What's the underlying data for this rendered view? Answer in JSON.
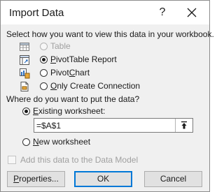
{
  "window": {
    "title": "Import Data",
    "help_glyph": "?",
    "close_icon": "close-icon"
  },
  "view_section": {
    "heading": "Select how you want to view this data in your workbook.",
    "options": [
      {
        "label": "Table",
        "selected": false,
        "enabled": false,
        "icon": "table-icon"
      },
      {
        "label": "PivotTable Report",
        "selected": true,
        "enabled": true,
        "icon": "pivottable-icon"
      },
      {
        "label": "PivotChart",
        "selected": false,
        "enabled": true,
        "icon": "pivotchart-icon"
      },
      {
        "label": "Only Create Connection",
        "selected": false,
        "enabled": true,
        "icon": "connection-icon"
      }
    ]
  },
  "location_section": {
    "heading": "Where do you want to put the data?",
    "existing_label": "Existing worksheet:",
    "existing_selected": true,
    "cell_reference": "=$A$1",
    "collapse_icon": "range-collapse-icon",
    "new_label": "New worksheet",
    "new_selected": false
  },
  "data_model": {
    "label": "Add this data to the Data Model",
    "checked": false,
    "enabled": false
  },
  "buttons": {
    "properties": "Properties...",
    "ok": "OK",
    "cancel": "Cancel"
  },
  "colors": {
    "default_button_border": "#0078d7",
    "dialog_background": "#f0f0f0"
  }
}
